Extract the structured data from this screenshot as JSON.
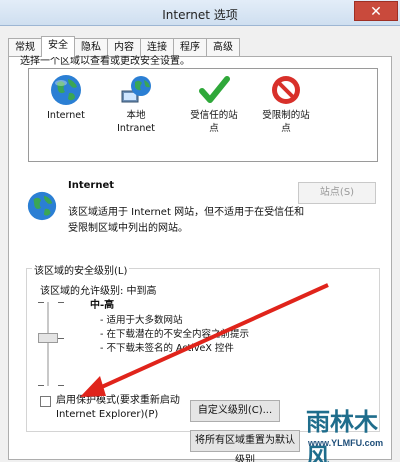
{
  "window": {
    "title": "Internet 选项",
    "close_symbol": "✕"
  },
  "tabs": [
    "常规",
    "安全",
    "隐私",
    "内容",
    "连接",
    "程序",
    "高级"
  ],
  "zones": {
    "prompt": "选择一个区域以查看或更改安全设置。",
    "items": [
      {
        "label": "Internet",
        "icon": "globe-icon"
      },
      {
        "label": "本地\nIntranet",
        "icon": "intranet-icon"
      },
      {
        "label": "受信任的站\n点",
        "icon": "checkmark-icon"
      },
      {
        "label": "受限制的站\n点",
        "icon": "no-entry-icon"
      }
    ]
  },
  "info": {
    "title": "Internet",
    "sites_button": "站点(S)",
    "description": "该区域适用于 Internet 网站，但不适用于在受信任和受限制区域中列出的网站。"
  },
  "security_level": {
    "legend": "该区域的安全级别(L)",
    "allowed": "该区域的允许级别: 中到高",
    "level_name": "中-高",
    "bullets": [
      "- 适用于大多数网站",
      "- 在下载潜在的不安全内容之前提示",
      "- 不下载未签名的 ActiveX 控件"
    ]
  },
  "protected_mode": {
    "label_line1": "启用保护模式(要求重新启动",
    "label_line2": "Internet Explorer)(P)",
    "checked": false
  },
  "buttons": {
    "custom_level": "自定义级别(C)...",
    "default_level": "将所有区域重置为默认级别"
  },
  "watermark": {
    "text": "雨林木风",
    "url": "www.YLMFU.com"
  },
  "colors": {
    "arrow": "#e0241b",
    "close": "#c94a3c"
  }
}
